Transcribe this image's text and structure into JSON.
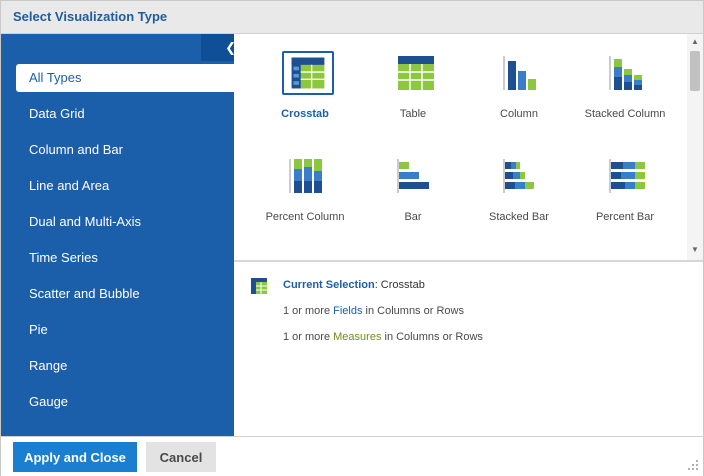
{
  "dialog": {
    "title": "Select Visualization Type"
  },
  "sidebar": {
    "collapse_icon": "chevron-left-icon",
    "items": [
      {
        "label": "All Types",
        "active": true
      },
      {
        "label": "Data Grid"
      },
      {
        "label": "Column and Bar"
      },
      {
        "label": "Line and Area"
      },
      {
        "label": "Dual and Multi-Axis"
      },
      {
        "label": "Time Series"
      },
      {
        "label": "Scatter and Bubble"
      },
      {
        "label": "Pie"
      },
      {
        "label": "Range"
      },
      {
        "label": "Gauge"
      }
    ]
  },
  "gallery": {
    "tiles": [
      {
        "label": "Crosstab",
        "icon": "crosstab-icon",
        "selected": true
      },
      {
        "label": "Table",
        "icon": "table-icon"
      },
      {
        "label": "Column",
        "icon": "column-chart-icon"
      },
      {
        "label": "Stacked Column",
        "icon": "stacked-column-icon"
      },
      {
        "label": "Percent Column",
        "icon": "percent-column-icon"
      },
      {
        "label": "Bar",
        "icon": "bar-chart-icon"
      },
      {
        "label": "Stacked Bar",
        "icon": "stacked-bar-icon"
      },
      {
        "label": "Percent Bar",
        "icon": "percent-bar-icon"
      }
    ]
  },
  "selection": {
    "current_label": "Current Selection",
    "current_value": ": Crosstab",
    "req1_prefix": "1 or more ",
    "req1_highlight": "Fields",
    "req1_suffix": " in Columns or Rows",
    "req2_prefix": "1 or more ",
    "req2_highlight": "Measures",
    "req2_suffix": " in Columns or Rows"
  },
  "footer": {
    "apply_label": "Apply and Close",
    "cancel_label": "Cancel"
  },
  "colors": {
    "brand_blue": "#1b5fab",
    "accent_green": "#8dc63f",
    "primary_button": "#1b7fd1"
  }
}
